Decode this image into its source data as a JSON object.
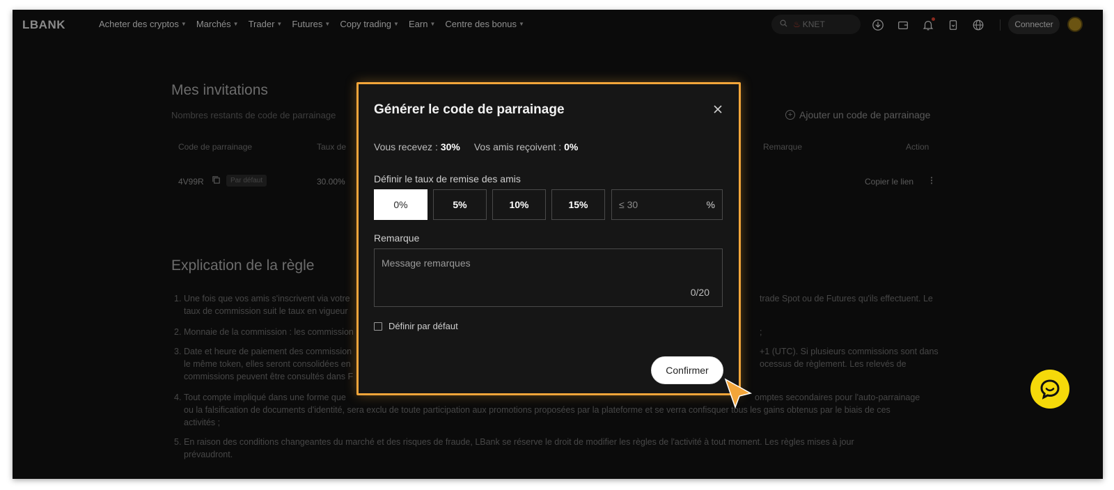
{
  "nav": {
    "logo": "LBANK",
    "menu": [
      {
        "label": "Acheter des cryptos"
      },
      {
        "label": "Marchés"
      },
      {
        "label": "Trader"
      },
      {
        "label": "Futures"
      },
      {
        "label": "Copy trading"
      },
      {
        "label": "Earn"
      },
      {
        "label": "Centre des bonus"
      }
    ],
    "search_placeholder": "KNET",
    "connect_label": "Connecter",
    "icons": [
      "download-icon",
      "wallet-icon",
      "bell-icon",
      "mobile-app-icon",
      "globe-icon"
    ]
  },
  "page": {
    "invitations_title": "Mes invitations",
    "invitations_subtitle": "Nombres restants de code de parrainage",
    "add_code_label": "Ajouter un code de parrainage",
    "table_headers": {
      "code": "Code de parrainage",
      "rate": "Taux de",
      "remark": "Remarque",
      "action": "Action"
    },
    "row": {
      "code": "4V99R",
      "badge": "Par défaut",
      "rate": "30.00%",
      "copy_link": "Copier le lien"
    },
    "rules_title": "Explication de la règle",
    "rules": [
      {
        "num": "1.",
        "text_a": "Une fois que vos amis s'inscrivent via votre",
        "text_b": "trade Spot ou de Futures qu'ils effectuent. Le",
        "text_c": "taux de commission suit le taux en vigueur"
      },
      {
        "num": "2.",
        "text_a": "Monnaie de la commission : les commission",
        "text_b": ";"
      },
      {
        "num": "3.",
        "text_a": "Date et heure de paiement des commission",
        "text_b": "+1 (UTC). Si plusieurs commissions sont dans",
        "text_c": "le même token, elles seront consolidées en",
        "text_d": "ocessus de règlement. Les relevés de",
        "text_e": "commissions peuvent être consultés dans F"
      },
      {
        "num": "4.",
        "text_a": "Tout compte impliqué dans une forme que",
        "text_b": "omptes secondaires pour l'auto-parrainage",
        "text_c": "ou la falsification de documents d'identité, sera exclu de toute participation aux promotions proposées par la plateforme et se verra confisquer tous les gains obtenus par le biais de ces",
        "text_d": "activités ;"
      },
      {
        "num": "5.",
        "text_a": "En raison des conditions changeantes du marché et des risques de fraude, LBank se réserve le droit de modifier les règles de l'activité à tout moment. Les règles mises à jour",
        "text_b": "prévaudront."
      }
    ]
  },
  "modal": {
    "title": "Générer le code de parrainage",
    "you_receive_label": "Vous recevez :",
    "you_receive_value": "30%",
    "friends_receive_label": "Vos amis reçoivent :",
    "friends_receive_value": "0%",
    "rate_label": "Définir le taux de remise des amis",
    "rate_options": [
      "0%",
      "5%",
      "10%",
      "15%"
    ],
    "selected_rate": "0%",
    "custom_rate_placeholder": "≤ 30",
    "custom_rate_unit": "%",
    "remark_label": "Remarque",
    "remark_placeholder": "Message remarques",
    "remark_counter": "0/20",
    "default_label": "Définir par défaut",
    "confirm_label": "Confirmer"
  },
  "colors": {
    "highlight": "#f2a53a",
    "chat_button": "#f5d90a",
    "modal_bg": "#161616",
    "page_bg": "#0b0b0b"
  }
}
